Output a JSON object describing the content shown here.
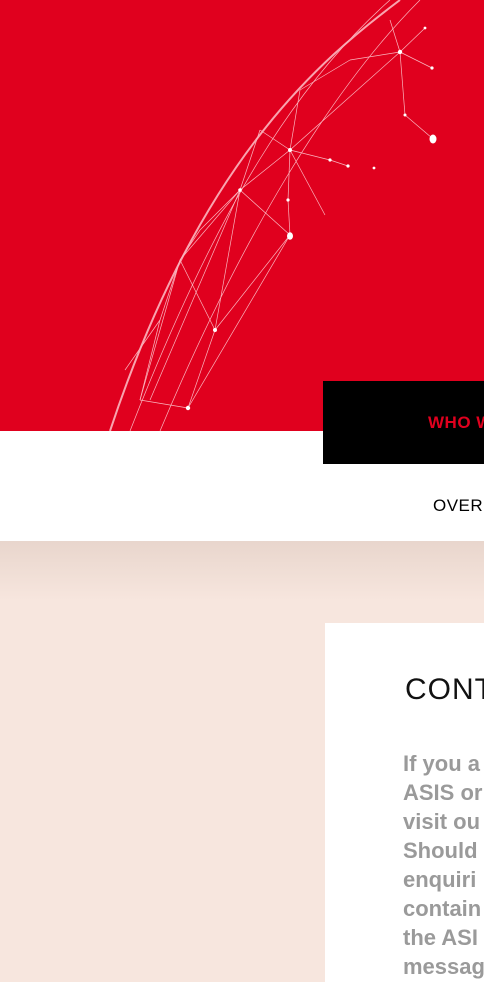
{
  "hero": {
    "accent_color": "#e0001e",
    "tab_label": "WHO W"
  },
  "nav": {
    "overview_label": "OVER"
  },
  "contact": {
    "title": "CONT",
    "lines": [
      "If you a",
      "ASIS or",
      "visit ou",
      "Should",
      "enquiri",
      "contain",
      "the ASI",
      "messag"
    ]
  },
  "colors": {
    "hero_red": "#e0001e",
    "beige": "#f7e6de",
    "tab_black": "#000000",
    "body_grey": "#9a9a9a"
  }
}
